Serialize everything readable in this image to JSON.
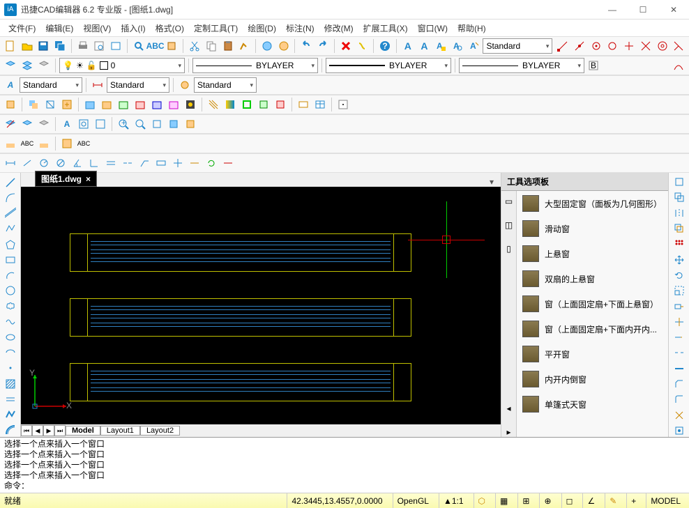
{
  "title": "迅捷CAD编辑器 6.2 专业版  - [图纸1.dwg]",
  "menus": [
    "文件(F)",
    "编辑(E)",
    "视图(V)",
    "插入(I)",
    "格式(O)",
    "定制工具(T)",
    "绘图(D)",
    "标注(N)",
    "修改(M)",
    "扩展工具(X)",
    "窗口(W)",
    "帮助(H)"
  ],
  "text_style_combo": "Standard",
  "layer_combo": "0",
  "linetype_combo": "BYLAYER",
  "lineweight_combo": "BYLAYER",
  "plotstyle_combo": "BYLAYER",
  "dim_style": "Standard",
  "dim_style2": "Standard",
  "dim_style3": "Standard",
  "doc_tab": "图纸1.dwg",
  "layout_tabs": {
    "model": "Model",
    "l1": "Layout1",
    "l2": "Layout2"
  },
  "palette_title": "工具选项板",
  "palette_items": [
    "大型固定窗（面板为几何图形）",
    "滑动窗",
    "上悬窗",
    "双扇的上悬窗",
    "窗（上面固定扇+下面上悬窗）",
    "窗（上面固定扇+下面内开内...",
    "平开窗",
    "内开内倒窗",
    "单篷式天窗"
  ],
  "cmd_lines": [
    "选择一个点来插入一个窗口",
    "选择一个点来插入一个窗口",
    "选择一个点来插入一个窗口",
    "选择一个点来插入一个窗口"
  ],
  "cmd_prompt": "命令：",
  "status_left": "就绪",
  "status_coords": "42.3445,13.4557,0.0000",
  "status_gl": "OpenGL",
  "status_scale": "1:1",
  "status_model": "MODEL",
  "ucs_labels": {
    "x": "X",
    "y": "Y"
  }
}
